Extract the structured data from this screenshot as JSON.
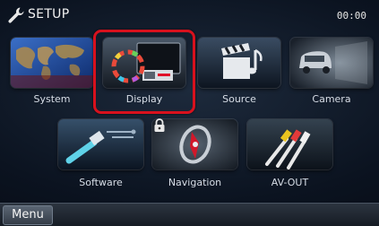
{
  "header": {
    "title": "SETUP",
    "title_icon": "wrench-icon",
    "clock": "00:00"
  },
  "tiles": [
    {
      "label": "System",
      "icon": "world-map-icon",
      "selected": false
    },
    {
      "label": "Display",
      "icon": "color-wheel-icon",
      "selected": true
    },
    {
      "label": "Source",
      "icon": "clapperboard-music-icon",
      "selected": false
    },
    {
      "label": "Camera",
      "icon": "car-rear-camera-icon",
      "selected": false
    },
    {
      "label": "Software",
      "icon": "usb-plug-icon",
      "selected": false,
      "locked": false
    },
    {
      "label": "Navigation",
      "icon": "compass-icon",
      "selected": false,
      "locked": true
    },
    {
      "label": "AV-OUT",
      "icon": "rca-cables-icon",
      "selected": false
    }
  ],
  "bottom": {
    "menu_label": "Menu"
  },
  "colors": {
    "highlight": "#d8111d",
    "background": "#0b1320"
  }
}
